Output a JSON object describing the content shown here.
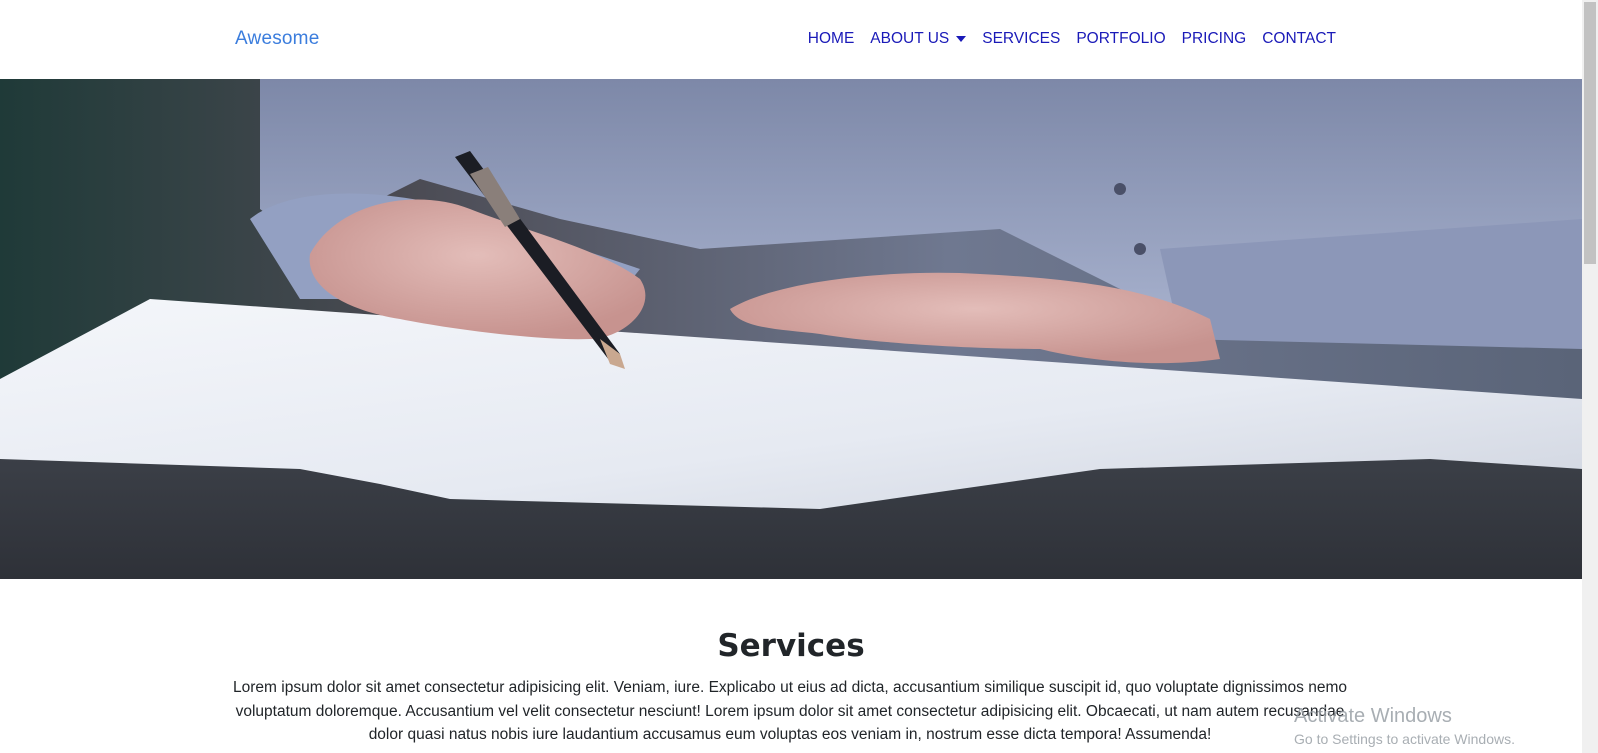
{
  "navbar": {
    "brand": "Awesome",
    "items": [
      {
        "label": "HOME"
      },
      {
        "label": "ABOUT US",
        "dropdown": true
      },
      {
        "label": "SERVICES"
      },
      {
        "label": "PORTFOLIO"
      },
      {
        "label": "PRICING"
      },
      {
        "label": "CONTACT"
      }
    ]
  },
  "hero": {
    "image": "photo of hand writing with pen on paper"
  },
  "services": {
    "title": "Services",
    "text": "Lorem ipsum dolor sit amet consectetur adipisicing elit. Veniam, iure. Explicabo ut eius ad dicta, accusantium similique suscipit id, quo voluptate dignissimos nemo voluptatum doloremque. Accusantium vel velit consectetur nesciunt! Lorem ipsum dolor sit amet consectetur adipisicing elit. Obcaecati, ut nam autem recusandae dolor quasi natus nobis iure laudantium accusamus eum voluptas eos veniam in, nostrum esse dicta tempora! Assumenda!"
  },
  "watermark": {
    "title": "Activate Windows",
    "subtitle": "Go to Settings to activate Windows."
  },
  "colors": {
    "brand": "#3b7ddd",
    "nav_link": "#1a1ab8",
    "text": "#212529"
  }
}
